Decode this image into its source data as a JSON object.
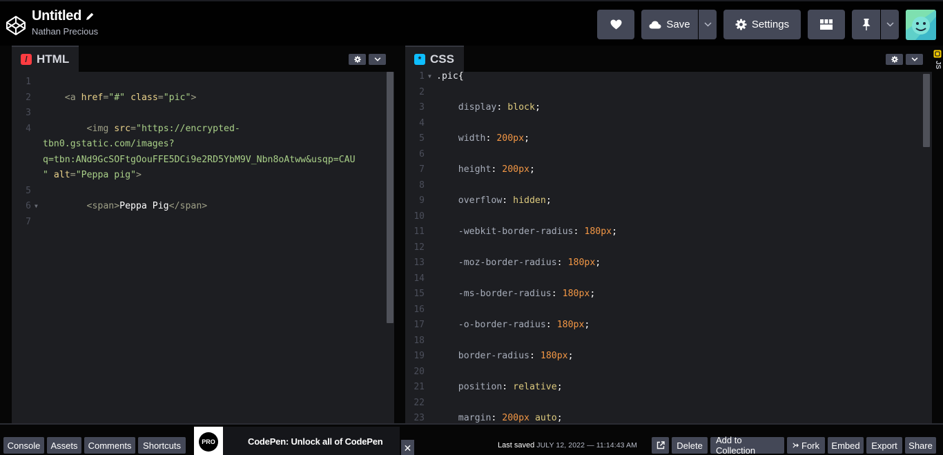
{
  "header": {
    "title": "Untitled",
    "author": "Nathan Precious",
    "save_label": "Save",
    "settings_label": "Settings",
    "icons": [
      "codepen-logo-icon",
      "pencil-icon",
      "heart-icon",
      "cloud-icon",
      "chevron-down-icon",
      "gear-icon",
      "layout-icon",
      "pin-icon",
      "chevron-down-icon",
      "avatar"
    ]
  },
  "html_pane": {
    "tab_label": "HTML",
    "tab_icon": "/",
    "lines": [
      {
        "n": "1",
        "fold": false,
        "tokens": []
      },
      {
        "n": "2",
        "fold": false,
        "tokens": [
          {
            "t": "    <a ",
            "c": "tg"
          },
          {
            "t": "href",
            "c": "at"
          },
          {
            "t": "=",
            "c": "tg"
          },
          {
            "t": "\"#\"",
            "c": "st"
          },
          {
            "t": " ",
            "c": "tg"
          },
          {
            "t": "class",
            "c": "at"
          },
          {
            "t": "=",
            "c": "tg"
          },
          {
            "t": "\"pic\"",
            "c": "st"
          },
          {
            "t": ">",
            "c": "tg"
          }
        ]
      },
      {
        "n": "3",
        "fold": false,
        "tokens": []
      },
      {
        "n": "4",
        "fold": false,
        "tokens": [
          {
            "t": "        <img ",
            "c": "tg"
          },
          {
            "t": "src",
            "c": "at"
          },
          {
            "t": "=",
            "c": "tg"
          },
          {
            "t": "\"https://encrypted-",
            "c": "st"
          }
        ]
      },
      {
        "n": "",
        "fold": false,
        "tokens": [
          {
            "t": "tbn0.gstatic.com/images?",
            "c": "st"
          }
        ]
      },
      {
        "n": "",
        "fold": false,
        "tokens": [
          {
            "t": "q=tbn:ANd9GcSOFtgOouFFE5DCi9e2RD5YbM9V_Nbn8oAtww&usqp=CAU",
            "c": "st"
          }
        ]
      },
      {
        "n": "",
        "fold": false,
        "tokens": [
          {
            "t": "\"",
            "c": "st"
          },
          {
            "t": " ",
            "c": "tg"
          },
          {
            "t": "alt",
            "c": "at"
          },
          {
            "t": "=",
            "c": "tg"
          },
          {
            "t": "\"Peppa pig\"",
            "c": "st"
          },
          {
            "t": ">",
            "c": "tg"
          }
        ]
      },
      {
        "n": "5",
        "fold": false,
        "tokens": []
      },
      {
        "n": "6",
        "fold": true,
        "tokens": [
          {
            "t": "        <span>",
            "c": "tg"
          },
          {
            "t": "Peppa Pig",
            "c": "plain"
          },
          {
            "t": "</span>",
            "c": "tg"
          }
        ]
      },
      {
        "n": "7",
        "fold": false,
        "tokens": []
      }
    ]
  },
  "css_pane": {
    "tab_label": "CSS",
    "tab_icon": "*",
    "lines": [
      {
        "n": "1",
        "fold": true,
        "tokens": [
          {
            "t": ".pic",
            "c": "sel"
          },
          {
            "t": "{",
            "c": "plain"
          }
        ]
      },
      {
        "n": "2",
        "fold": false,
        "tokens": []
      },
      {
        "n": "3",
        "fold": false,
        "tokens": [
          {
            "t": "    display",
            "c": "prop"
          },
          {
            "t": ": ",
            "c": "plain"
          },
          {
            "t": "block",
            "c": "val"
          },
          {
            "t": ";",
            "c": "plain"
          }
        ]
      },
      {
        "n": "4",
        "fold": false,
        "tokens": []
      },
      {
        "n": "5",
        "fold": false,
        "tokens": [
          {
            "t": "    width",
            "c": "prop"
          },
          {
            "t": ": ",
            "c": "plain"
          },
          {
            "t": "200px",
            "c": "num"
          },
          {
            "t": ";",
            "c": "plain"
          }
        ]
      },
      {
        "n": "6",
        "fold": false,
        "tokens": []
      },
      {
        "n": "7",
        "fold": false,
        "tokens": [
          {
            "t": "    height",
            "c": "prop"
          },
          {
            "t": ": ",
            "c": "plain"
          },
          {
            "t": "200px",
            "c": "num"
          },
          {
            "t": ";",
            "c": "plain"
          }
        ]
      },
      {
        "n": "8",
        "fold": false,
        "tokens": []
      },
      {
        "n": "9",
        "fold": false,
        "tokens": [
          {
            "t": "    overflow",
            "c": "prop"
          },
          {
            "t": ": ",
            "c": "plain"
          },
          {
            "t": "hidden",
            "c": "val"
          },
          {
            "t": ";",
            "c": "plain"
          }
        ]
      },
      {
        "n": "10",
        "fold": false,
        "tokens": []
      },
      {
        "n": "11",
        "fold": false,
        "tokens": [
          {
            "t": "    -webkit-border-radius",
            "c": "prop"
          },
          {
            "t": ": ",
            "c": "plain"
          },
          {
            "t": "180px",
            "c": "num"
          },
          {
            "t": ";",
            "c": "plain"
          }
        ]
      },
      {
        "n": "12",
        "fold": false,
        "tokens": []
      },
      {
        "n": "13",
        "fold": false,
        "tokens": [
          {
            "t": "    -moz-border-radius",
            "c": "prop"
          },
          {
            "t": ": ",
            "c": "plain"
          },
          {
            "t": "180px",
            "c": "num"
          },
          {
            "t": ";",
            "c": "plain"
          }
        ]
      },
      {
        "n": "14",
        "fold": false,
        "tokens": []
      },
      {
        "n": "15",
        "fold": false,
        "tokens": [
          {
            "t": "    -ms-border-radius",
            "c": "prop"
          },
          {
            "t": ": ",
            "c": "plain"
          },
          {
            "t": "180px",
            "c": "num"
          },
          {
            "t": ";",
            "c": "plain"
          }
        ]
      },
      {
        "n": "16",
        "fold": false,
        "tokens": []
      },
      {
        "n": "17",
        "fold": false,
        "tokens": [
          {
            "t": "    -o-border-radius",
            "c": "prop"
          },
          {
            "t": ": ",
            "c": "plain"
          },
          {
            "t": "180px",
            "c": "num"
          },
          {
            "t": ";",
            "c": "plain"
          }
        ]
      },
      {
        "n": "18",
        "fold": false,
        "tokens": []
      },
      {
        "n": "19",
        "fold": false,
        "tokens": [
          {
            "t": "    border-radius",
            "c": "prop"
          },
          {
            "t": ": ",
            "c": "plain"
          },
          {
            "t": "180px",
            "c": "num"
          },
          {
            "t": ";",
            "c": "plain"
          }
        ]
      },
      {
        "n": "20",
        "fold": false,
        "tokens": []
      },
      {
        "n": "21",
        "fold": false,
        "tokens": [
          {
            "t": "    position",
            "c": "prop"
          },
          {
            "t": ": ",
            "c": "plain"
          },
          {
            "t": "relative",
            "c": "val"
          },
          {
            "t": ";",
            "c": "plain"
          }
        ]
      },
      {
        "n": "22",
        "fold": false,
        "tokens": []
      },
      {
        "n": "23",
        "fold": false,
        "tokens": [
          {
            "t": "    margin",
            "c": "prop"
          },
          {
            "t": ": ",
            "c": "plain"
          },
          {
            "t": "200px",
            "c": "num"
          },
          {
            "t": " ",
            "c": "plain"
          },
          {
            "t": "auto",
            "c": "val"
          },
          {
            "t": ";",
            "c": "plain"
          }
        ]
      }
    ]
  },
  "side_strip": {
    "label": "JS"
  },
  "footer": {
    "buttons_left": [
      "Console",
      "Assets",
      "Comments",
      "Shortcuts"
    ],
    "promo": {
      "badge": "PRO",
      "text": "CodePen: Unlock all of CodePen",
      "close": "✕"
    },
    "last_saved_label": "Last saved",
    "last_saved_date": "JULY 12, 2022 — 11:14:43 AM",
    "buttons_right": [
      "Delete",
      "Add to Collection",
      "Fork",
      "Embed",
      "Export",
      "Share"
    ]
  },
  "colors": {
    "accent_html": "#ff3c41",
    "accent_css": "#0ebeff",
    "button_bg": "#444857",
    "editor_bg": "#1d1e22"
  }
}
